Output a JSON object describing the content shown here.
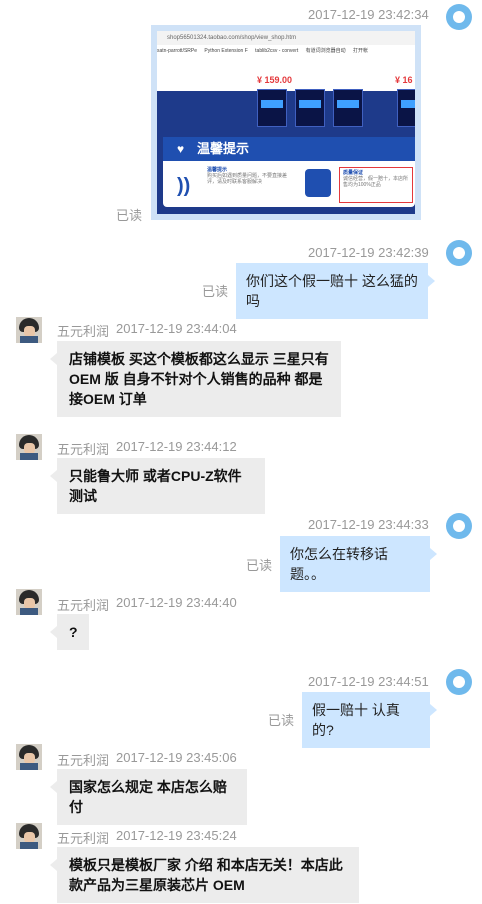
{
  "read_label": "已读",
  "other_name": "五元利润",
  "screenshot": {
    "url": "shop56501324.taobao.com/shop/view_shop.htm",
    "tabs": [
      "satn-parrott/SRPe",
      "Python Extension F",
      "tablib2csv - convert",
      "有道词浏览器自动",
      "打开帐"
    ],
    "price_left": "¥ 159.00",
    "price_right": "¥ 16",
    "banner_title": "温馨提示",
    "col1_title": "温馨提示",
    "col1_text": "购买后如遇到质量问题，不要直接差评，请及时联系客服解决",
    "col2_title": "质量保证",
    "col2_text": "诚信经营，假一赔十，本店所售均为100%正品"
  },
  "messages": [
    {
      "side": "me",
      "time": "2017-12-19 23:42:34",
      "kind": "image"
    },
    {
      "side": "me",
      "time": "2017-12-19 23:42:39",
      "text": "你们这个假一赔十 这么猛的吗"
    },
    {
      "side": "other",
      "time": "2017-12-19 23:44:04",
      "text": "店铺模板 买这个模板都这么显示  三星只有OEM 版  自身不针对个人销售的品种 都是接OEM 订单"
    },
    {
      "side": "other",
      "time": "2017-12-19 23:44:12",
      "text": "只能鲁大师 或者CPU-Z软件测试"
    },
    {
      "side": "me",
      "time": "2017-12-19 23:44:33",
      "text": "你怎么在转移话题。。"
    },
    {
      "side": "other",
      "time": "2017-12-19 23:44:40",
      "text": "?"
    },
    {
      "side": "me",
      "time": "2017-12-19 23:44:51",
      "text": "假一赔十 认真的?"
    },
    {
      "side": "other",
      "time": "2017-12-19 23:45:06",
      "text": "国家怎么规定 本店怎么赔付"
    },
    {
      "side": "other",
      "time": "2017-12-19 23:45:24",
      "text": "模板只是模板厂家 介绍  和本店无关！本店此款产品为三星原装芯片 OEM"
    }
  ]
}
